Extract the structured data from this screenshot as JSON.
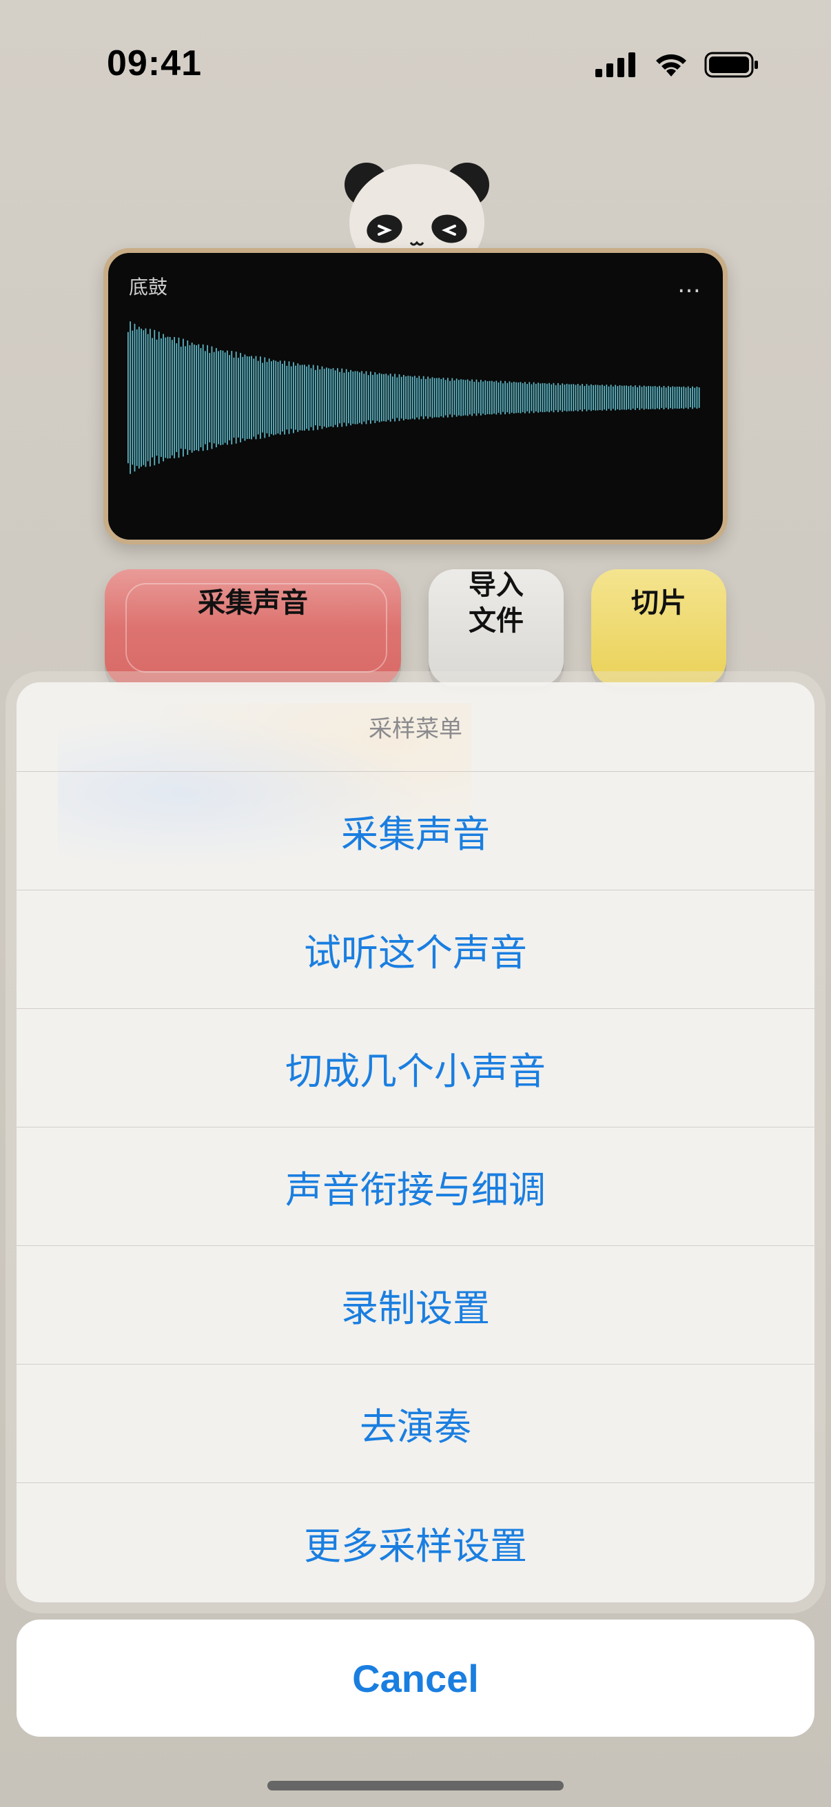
{
  "status_bar": {
    "time": "09:41"
  },
  "wave_card": {
    "title": "底鼓",
    "more_icon": "…",
    "wave_color": "#5fb8c8"
  },
  "buttons": {
    "collect": "采集声音",
    "import_line1": "导入",
    "import_line2": "文件",
    "slice": "切片"
  },
  "action_sheet": {
    "title": "采样菜单",
    "items": [
      "采集声音",
      "试听这个声音",
      "切成几个小声音",
      "声音衔接与细调",
      "录制设置",
      "去演奏",
      "更多采样设置"
    ],
    "cancel": "Cancel",
    "accent": "#1a7ee0"
  }
}
